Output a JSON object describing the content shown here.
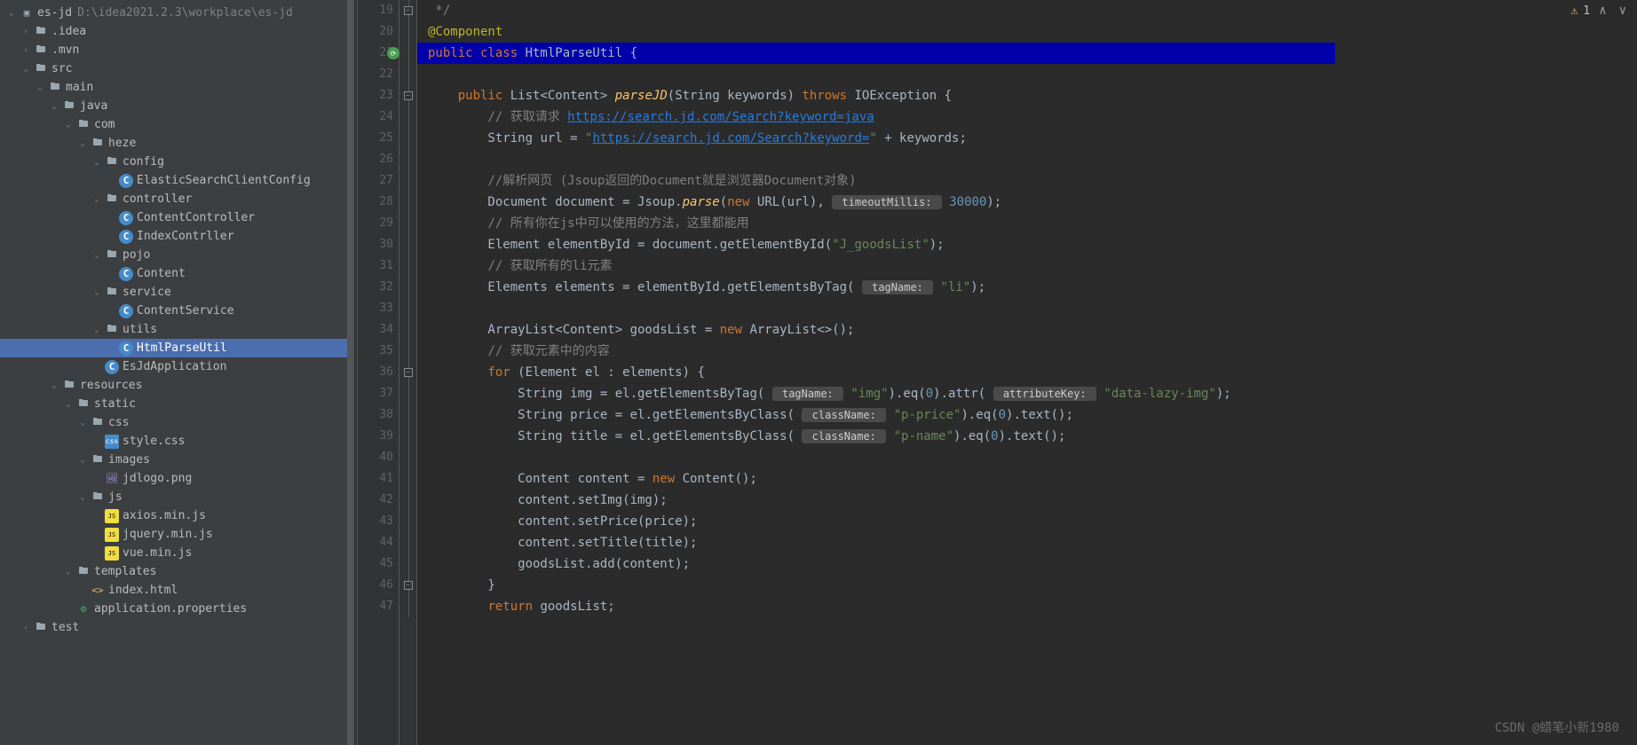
{
  "project": {
    "name": "es-jd",
    "path": "D:\\idea2021.2.3\\workplace\\es-jd"
  },
  "tree": [
    {
      "d": 0,
      "open": true,
      "icon": "proj",
      "label": "es-jd",
      "extra": "D:\\idea2021.2.3\\workplace\\es-jd"
    },
    {
      "d": 1,
      "arrow": ">",
      "icon": "folder",
      "label": ".idea"
    },
    {
      "d": 1,
      "arrow": ">",
      "icon": "folder",
      "label": ".mvn"
    },
    {
      "d": 1,
      "open": true,
      "icon": "folder",
      "label": "src"
    },
    {
      "d": 2,
      "open": true,
      "icon": "folder",
      "label": "main"
    },
    {
      "d": 3,
      "open": true,
      "icon": "folder",
      "label": "java"
    },
    {
      "d": 4,
      "open": true,
      "icon": "folder",
      "label": "com"
    },
    {
      "d": 5,
      "open": true,
      "icon": "folder",
      "label": "heze"
    },
    {
      "d": 6,
      "open": true,
      "icon": "folder",
      "label": "config"
    },
    {
      "d": 7,
      "icon": "cls",
      "label": "ElasticSearchClientConfig"
    },
    {
      "d": 6,
      "open": true,
      "icon": "folder",
      "label": "controller"
    },
    {
      "d": 7,
      "icon": "cls",
      "label": "ContentController"
    },
    {
      "d": 7,
      "icon": "cls",
      "label": "IndexContrller"
    },
    {
      "d": 6,
      "open": true,
      "icon": "folder",
      "label": "pojo"
    },
    {
      "d": 7,
      "icon": "cls",
      "label": "Content"
    },
    {
      "d": 6,
      "open": true,
      "icon": "folder",
      "label": "service"
    },
    {
      "d": 7,
      "icon": "cls",
      "label": "ContentService"
    },
    {
      "d": 6,
      "open": true,
      "icon": "folder",
      "label": "utils"
    },
    {
      "d": 7,
      "icon": "cls",
      "label": "HtmlParseUtil",
      "sel": true
    },
    {
      "d": 6,
      "icon": "cls",
      "label": "EsJdApplication"
    },
    {
      "d": 3,
      "open": true,
      "icon": "folder",
      "label": "resources"
    },
    {
      "d": 4,
      "open": true,
      "icon": "folder",
      "label": "static"
    },
    {
      "d": 5,
      "open": true,
      "icon": "folder",
      "label": "css"
    },
    {
      "d": 6,
      "icon": "css",
      "label": "style.css"
    },
    {
      "d": 5,
      "open": true,
      "icon": "folder",
      "label": "images"
    },
    {
      "d": 6,
      "icon": "png",
      "label": "jdlogo.png"
    },
    {
      "d": 5,
      "open": true,
      "icon": "folder",
      "label": "js"
    },
    {
      "d": 6,
      "icon": "js",
      "label": "axios.min.js"
    },
    {
      "d": 6,
      "icon": "js",
      "label": "jquery.min.js"
    },
    {
      "d": 6,
      "icon": "js",
      "label": "vue.min.js"
    },
    {
      "d": 4,
      "open": true,
      "icon": "folder",
      "label": "templates"
    },
    {
      "d": 5,
      "icon": "html",
      "label": "index.html"
    },
    {
      "d": 4,
      "icon": "prop",
      "label": "application.properties"
    },
    {
      "d": 1,
      "arrow": ">",
      "icon": "folder",
      "label": "test"
    }
  ],
  "lines": [
    {
      "n": 19,
      "fold": "close",
      "segs": [
        {
          "t": " */",
          "c": "com"
        }
      ]
    },
    {
      "n": 20,
      "segs": [
        {
          "t": "@Component",
          "c": "ann"
        }
      ]
    },
    {
      "n": 21,
      "curr": true,
      "green": true,
      "segs": [
        {
          "t": "public class ",
          "c": "kw"
        },
        {
          "t": "HtmlParseUtil ",
          "c": "typ"
        },
        {
          "t": "{",
          "c": "typ"
        }
      ]
    },
    {
      "n": 22,
      "segs": []
    },
    {
      "n": 23,
      "fold": "open",
      "segs": [
        {
          "t": "    ",
          "c": ""
        },
        {
          "t": "public ",
          "c": "kw"
        },
        {
          "t": "List<Content> ",
          "c": "typ"
        },
        {
          "t": "parseJD",
          "c": "meth"
        },
        {
          "t": "(String keywords) ",
          "c": "typ"
        },
        {
          "t": "throws ",
          "c": "kw"
        },
        {
          "t": "IOException {",
          "c": "typ"
        }
      ]
    },
    {
      "n": 24,
      "segs": [
        {
          "t": "        ",
          "c": ""
        },
        {
          "t": "// 获取请求 ",
          "c": "com"
        },
        {
          "t": "https://search.jd.com/Search?keyword=java",
          "c": "link"
        }
      ]
    },
    {
      "n": 25,
      "segs": [
        {
          "t": "        String ",
          "c": "typ"
        },
        {
          "t": "url ",
          "c": "typ"
        },
        {
          "t": "= ",
          "c": "typ"
        },
        {
          "t": "\"",
          "c": "str"
        },
        {
          "t": "https://search.jd.com/Search?keyword=",
          "c": "link"
        },
        {
          "t": "\"",
          "c": "str"
        },
        {
          "t": " + keywords;",
          "c": "typ"
        }
      ]
    },
    {
      "n": 26,
      "segs": []
    },
    {
      "n": 27,
      "segs": [
        {
          "t": "        ",
          "c": ""
        },
        {
          "t": "//解析网页 (Jsoup返回的Document就是浏览器Document对象)",
          "c": "com"
        }
      ]
    },
    {
      "n": 28,
      "segs": [
        {
          "t": "        Document ",
          "c": "typ"
        },
        {
          "t": "document ",
          "c": "typ"
        },
        {
          "t": "= Jsoup.",
          "c": "typ"
        },
        {
          "t": "parse",
          "c": "meth"
        },
        {
          "t": "(",
          "c": "typ"
        },
        {
          "t": "new ",
          "c": "kw"
        },
        {
          "t": "URL(url), ",
          "c": "typ"
        },
        {
          "t": " timeoutMillis: ",
          "c": "hint"
        },
        {
          "t": " 30000",
          "c": "num"
        },
        {
          "t": ");",
          "c": "typ"
        }
      ]
    },
    {
      "n": 29,
      "segs": [
        {
          "t": "        ",
          "c": ""
        },
        {
          "t": "// 所有你在js中可以使用的方法，这里都能用",
          "c": "com"
        }
      ]
    },
    {
      "n": 30,
      "segs": [
        {
          "t": "        Element ",
          "c": "typ"
        },
        {
          "t": "elementById ",
          "c": "typ"
        },
        {
          "t": "= document.getElementById(",
          "c": "typ"
        },
        {
          "t": "\"J_goodsList\"",
          "c": "str"
        },
        {
          "t": ");",
          "c": "typ"
        }
      ]
    },
    {
      "n": 31,
      "segs": [
        {
          "t": "        ",
          "c": ""
        },
        {
          "t": "// 获取所有的li元素",
          "c": "com"
        }
      ]
    },
    {
      "n": 32,
      "segs": [
        {
          "t": "        Elements ",
          "c": "typ"
        },
        {
          "t": "elements ",
          "c": "typ"
        },
        {
          "t": "= elementById.getElementsByTag( ",
          "c": "typ"
        },
        {
          "t": " tagName: ",
          "c": "hint"
        },
        {
          "t": " \"li\"",
          "c": "str"
        },
        {
          "t": ");",
          "c": "typ"
        }
      ]
    },
    {
      "n": 33,
      "segs": []
    },
    {
      "n": 34,
      "segs": [
        {
          "t": "        ArrayList<Content> ",
          "c": "typ"
        },
        {
          "t": "goodsList ",
          "c": "typ"
        },
        {
          "t": "= ",
          "c": "typ"
        },
        {
          "t": "new ",
          "c": "kw"
        },
        {
          "t": "ArrayList<>();",
          "c": "typ"
        }
      ]
    },
    {
      "n": 35,
      "segs": [
        {
          "t": "        ",
          "c": ""
        },
        {
          "t": "// 获取元素中的内容",
          "c": "com"
        }
      ]
    },
    {
      "n": 36,
      "fold": "open",
      "segs": [
        {
          "t": "        ",
          "c": ""
        },
        {
          "t": "for ",
          "c": "kw"
        },
        {
          "t": "(Element el : elements) {",
          "c": "typ"
        }
      ]
    },
    {
      "n": 37,
      "segs": [
        {
          "t": "            String ",
          "c": "typ"
        },
        {
          "t": "img ",
          "c": "typ"
        },
        {
          "t": "= el.getElementsByTag( ",
          "c": "typ"
        },
        {
          "t": " tagName: ",
          "c": "hint"
        },
        {
          "t": " \"img\"",
          "c": "str"
        },
        {
          "t": ").eq(",
          "c": "typ"
        },
        {
          "t": "0",
          "c": "num"
        },
        {
          "t": ").attr( ",
          "c": "typ"
        },
        {
          "t": " attributeKey: ",
          "c": "hint"
        },
        {
          "t": " \"data-lazy-img\"",
          "c": "str"
        },
        {
          "t": ");",
          "c": "typ"
        }
      ]
    },
    {
      "n": 38,
      "segs": [
        {
          "t": "            String ",
          "c": "typ"
        },
        {
          "t": "price ",
          "c": "typ"
        },
        {
          "t": "= el.getElementsByClass( ",
          "c": "typ"
        },
        {
          "t": " className: ",
          "c": "hint"
        },
        {
          "t": " \"p-price\"",
          "c": "str"
        },
        {
          "t": ").eq(",
          "c": "typ"
        },
        {
          "t": "0",
          "c": "num"
        },
        {
          "t": ").text();",
          "c": "typ"
        }
      ]
    },
    {
      "n": 39,
      "segs": [
        {
          "t": "            String ",
          "c": "typ"
        },
        {
          "t": "title ",
          "c": "typ"
        },
        {
          "t": "= el.getElementsByClass( ",
          "c": "typ"
        },
        {
          "t": " className: ",
          "c": "hint"
        },
        {
          "t": " \"p-name\"",
          "c": "str"
        },
        {
          "t": ").eq(",
          "c": "typ"
        },
        {
          "t": "0",
          "c": "num"
        },
        {
          "t": ").text();",
          "c": "typ"
        }
      ]
    },
    {
      "n": 40,
      "segs": []
    },
    {
      "n": 41,
      "segs": [
        {
          "t": "            Content ",
          "c": "typ"
        },
        {
          "t": "content ",
          "c": "typ"
        },
        {
          "t": "= ",
          "c": "typ"
        },
        {
          "t": "new ",
          "c": "kw"
        },
        {
          "t": "Content();",
          "c": "typ"
        }
      ]
    },
    {
      "n": 42,
      "segs": [
        {
          "t": "            content.setImg(img);",
          "c": "typ"
        }
      ]
    },
    {
      "n": 43,
      "segs": [
        {
          "t": "            content.setPrice(price);",
          "c": "typ"
        }
      ]
    },
    {
      "n": 44,
      "segs": [
        {
          "t": "            content.setTitle(title);",
          "c": "typ"
        }
      ]
    },
    {
      "n": 45,
      "segs": [
        {
          "t": "            goodsList.add(content);",
          "c": "typ"
        }
      ]
    },
    {
      "n": 46,
      "fold": "close",
      "segs": [
        {
          "t": "        }",
          "c": "typ"
        }
      ]
    },
    {
      "n": 47,
      "segs": [
        {
          "t": "        ",
          "c": ""
        },
        {
          "t": "return ",
          "c": "kw"
        },
        {
          "t": "goodsList;",
          "c": "typ"
        }
      ]
    }
  ],
  "warnings": {
    "count": "1"
  },
  "watermark": "CSDN @蜡笔小新1980"
}
